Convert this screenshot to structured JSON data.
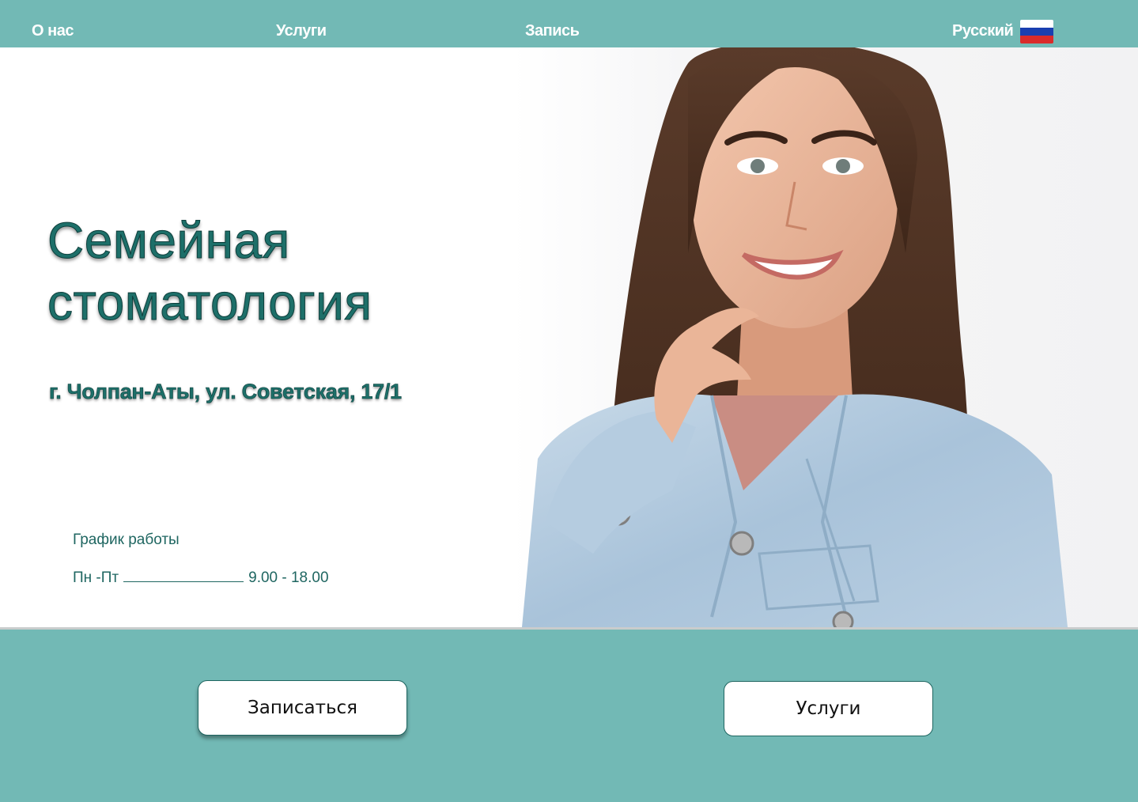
{
  "nav": {
    "about": "О нас",
    "services": "Услуги",
    "booking": "Запись",
    "language": "Русский",
    "flag_icon": "russia-flag-icon"
  },
  "hero": {
    "title_line1": "Семейная",
    "title_line2": "стоматология",
    "address": "г. Чолпан-Аты, ул. Советская, 17/1",
    "schedule_title": "График работы",
    "schedule_days": "Пн -Пт",
    "schedule_hours": "9.00 - 18.00",
    "photo": "smiling-woman-denim-jacket-photo"
  },
  "actions": {
    "book_label": "Записаться",
    "services_label": "Услуги"
  },
  "colors": {
    "accent": "#72b9b5",
    "title": "#1d6f69"
  }
}
